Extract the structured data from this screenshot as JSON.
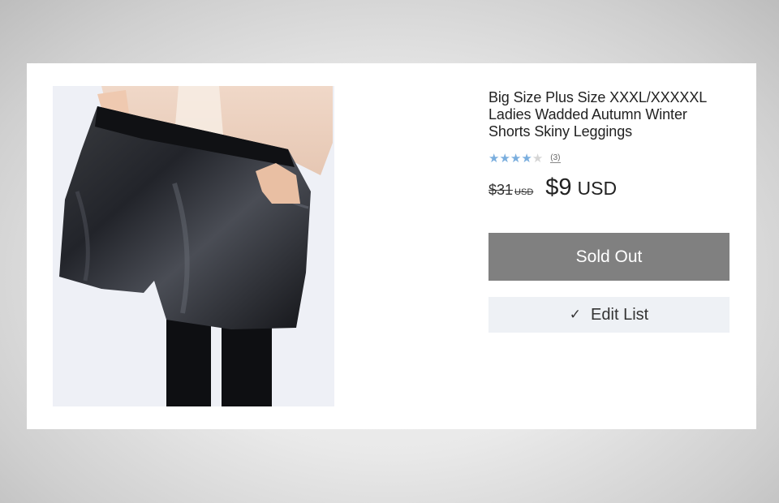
{
  "product": {
    "title": "Big Size Plus Size XXXL/XXXXXL Ladies Wadded Autumn Winter Shorts Skiny Leggings",
    "rating": {
      "stars_filled": 4,
      "stars_total": 5,
      "review_count": "(3)",
      "star_color": "#7aaede"
    },
    "price": {
      "old_amount": "$31",
      "old_currency": "USD",
      "new_amount": "$9",
      "new_currency": "USD"
    },
    "image": {
      "subject": "black faux-leather shorts over black leggings"
    }
  },
  "actions": {
    "sold_out_label": "Sold Out",
    "sold_out_color": "#808080",
    "edit_list_label": "Edit List",
    "edit_list_icon": "check-icon"
  }
}
